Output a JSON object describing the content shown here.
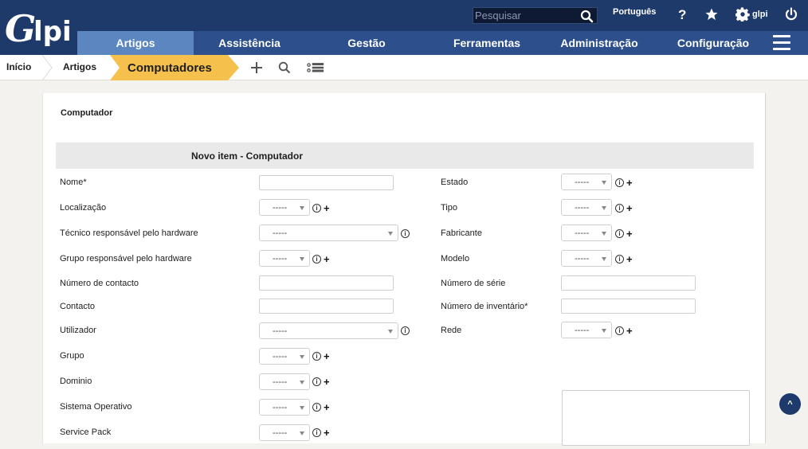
{
  "app": {
    "logo_text": "Glpi"
  },
  "topbar": {
    "search_placeholder": "Pesquisar",
    "language": "Português",
    "user": "glpi",
    "icons": [
      "search-icon",
      "help-icon",
      "star-icon",
      "gear-icon",
      "power-icon"
    ]
  },
  "menu": {
    "items": [
      "Artigos",
      "Assistência",
      "Gestão",
      "Ferramentas",
      "Administração",
      "Configuração"
    ],
    "active": "Artigos"
  },
  "breadcrumb": {
    "home": "Início",
    "section": "Artigos",
    "current": "Computadores",
    "tools": [
      "add-icon",
      "search-icon",
      "list-icon"
    ]
  },
  "card": {
    "title": "Computador",
    "form_header": "Novo item - Computador"
  },
  "form": {
    "left": {
      "name": "Nome*",
      "location": "Localização",
      "tech_user": "Técnico responsável pelo hardware",
      "tech_group": "Grupo responsável pelo hardware",
      "contact_num": "Número de contacto",
      "contact": "Contacto",
      "user": "Utilizador",
      "group": "Grupo",
      "domain": "Dominio",
      "os": "Sistema Operativo",
      "service_pack": "Service Pack"
    },
    "right": {
      "status": "Estado",
      "type": "Tipo",
      "manufacturer": "Fabricante",
      "model": "Modelo",
      "serial": "Número de série",
      "inventory": "Número de inventário*",
      "network": "Rede"
    },
    "dropdown_empty": "-----"
  },
  "colors": {
    "header": "#1d3a6b",
    "menu": "#2d4f8b",
    "menu_active": "#5b86c0",
    "breadcrumb_active": "#f6c04c"
  },
  "scroll_top_label": "^"
}
